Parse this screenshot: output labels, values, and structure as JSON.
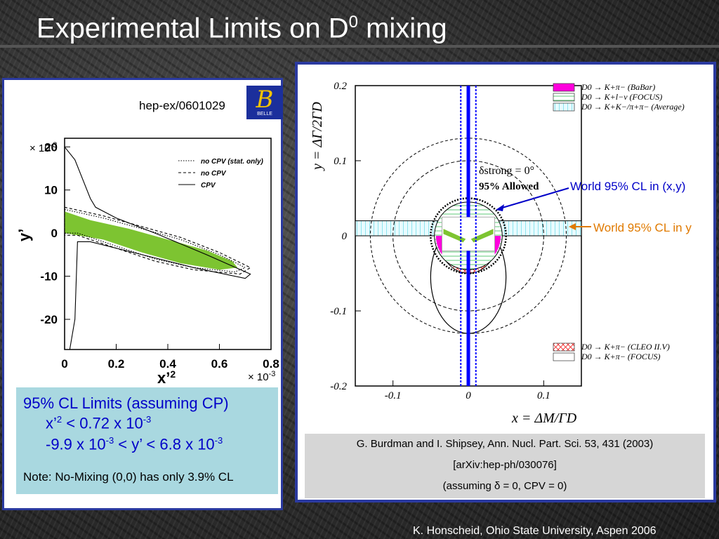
{
  "slide": {
    "title": "Experimental Limits on D",
    "title_sup": "0",
    "title_suffix": " mixing",
    "footer": "K. Honscheid, Ohio State University, Aspen 2006"
  },
  "left": {
    "reference": "hep-ex/0601029",
    "logo_text": "BELLE",
    "limits_heading": "95% CL Limits (assuming CP)",
    "limit_x_pre": "x’",
    "limit_x_sup": "2",
    "limit_x_mid": " < 0.72 x 10",
    "limit_x_exp": "-3",
    "limit_y_pre": "-9.9 x 10",
    "limit_y_exp1": "-3",
    "limit_y_mid": " < y’ < 6.8 x 10",
    "limit_y_exp2": "-3",
    "note": "Note: No-Mixing (0,0) has only 3.9% CL"
  },
  "right": {
    "citation": [
      "G. Burdman and I. Shipsey, Ann. Nucl. Part. Sci. 53, 431 (2003)",
      "[arXiv:hep-ph/030076]",
      "(assuming δ = 0, CPV = 0)"
    ],
    "annotation_xy": "World 95% CL in (x,y)",
    "annotation_y": "World 95% CL in y",
    "colors": {
      "annotation_xy": "#0000c8",
      "annotation_y": "#e07a00"
    }
  },
  "chart_data": [
    {
      "type": "area",
      "source": "hep-ex/0601029",
      "xlabel": "x’2",
      "ylabel": "y’",
      "x_scale_label": "× 10-3",
      "y_scale_label": "× 10-3",
      "xlim": [
        0,
        0.8
      ],
      "ylim": [
        -27,
        22
      ],
      "x_ticks": [
        "0",
        "0.2",
        "0.4",
        "0.6",
        "0.8"
      ],
      "y_ticks": [
        "20",
        "10",
        "0",
        "-10",
        "-20"
      ],
      "legend": [
        "no CPV (stat. only)",
        "no CPV",
        "CPV"
      ],
      "colors": {
        "allowed_region": "#7dc431"
      },
      "series": [
        {
          "name": "no CPV (stat. only)",
          "style": "dotted",
          "x": [
            0,
            0.15,
            0.3,
            0.45,
            0.6,
            0.7,
            0.66,
            0.5,
            0.35,
            0.2,
            0.05,
            0
          ],
          "y": [
            5.5,
            3.5,
            1,
            -1.5,
            -5,
            -8,
            -9,
            -8,
            -6,
            -3,
            0,
            0
          ]
        },
        {
          "name": "no CPV",
          "style": "dashed",
          "x": [
            0,
            0.15,
            0.3,
            0.45,
            0.6,
            0.72,
            0.68,
            0.5,
            0.35,
            0.2,
            0.05,
            0
          ],
          "y": [
            6,
            4,
            1.5,
            -1,
            -4.5,
            -8,
            -9.5,
            -8.5,
            -6.5,
            -3.5,
            -0.5,
            -0.5
          ]
        },
        {
          "name": "CPV",
          "style": "solid",
          "x": [
            0,
            0.04,
            0.1,
            0.12,
            0.2,
            0.35,
            0.55,
            0.72,
            0.7,
            0.5,
            0.3,
            0.1,
            0.05,
            0.04,
            0.02,
            0
          ],
          "y": [
            20,
            17,
            8,
            6,
            3.5,
            0,
            -5,
            -9.5,
            -10.5,
            -8,
            -5,
            -2,
            -2,
            -20,
            -27,
            -27
          ]
        }
      ],
      "allowed_region": {
        "x": [
          0,
          0.1,
          0.25,
          0.4,
          0.55,
          0.65,
          0.67,
          0.6,
          0.45,
          0.3,
          0.15,
          0
        ],
        "y": [
          5,
          3,
          1,
          -1.5,
          -4,
          -6.5,
          -8,
          -8.5,
          -7,
          -4.5,
          -1.5,
          0
        ]
      }
    },
    {
      "type": "scatter",
      "source": "Burdman and Shipsey",
      "xlabel": "x = ΔM/ΓD",
      "ylabel": "y = ΔΓ/2ΓD",
      "xlim": [
        -0.15,
        0.15
      ],
      "ylim": [
        -0.2,
        0.2
      ],
      "x_ticks": [
        "-0.1",
        "0",
        "0.1"
      ],
      "y_ticks": [
        "0.2",
        "0.1",
        "0",
        "-0.1",
        "-0.2"
      ],
      "strong_phase_label": "δstrong = 0°",
      "allowed_label": "95% Allowed",
      "legend_top": [
        "D0 → K+π− (BaBar)",
        "D0 → K+l−ν (FOCUS)",
        "D0 → K+K−/π+π− (Average)"
      ],
      "legend_bottom": [
        "D0 → K+π− (CLEO II.V)",
        "D0 → K+π− (FOCUS)"
      ],
      "colors": {
        "babar": "#ff00dd",
        "focus_semilep": "#33bb55",
        "average": "#33ccdd",
        "cleo": "#ee2222",
        "world_x": "#0000ff"
      },
      "world_xy_circle_radius": 0.03,
      "outer_circle_radius": 0.13,
      "mid_circle_radius": 0.1,
      "world_y_band": [
        0.0,
        0.02
      ],
      "world_x_band": [
        -0.01,
        0.01
      ]
    }
  ]
}
